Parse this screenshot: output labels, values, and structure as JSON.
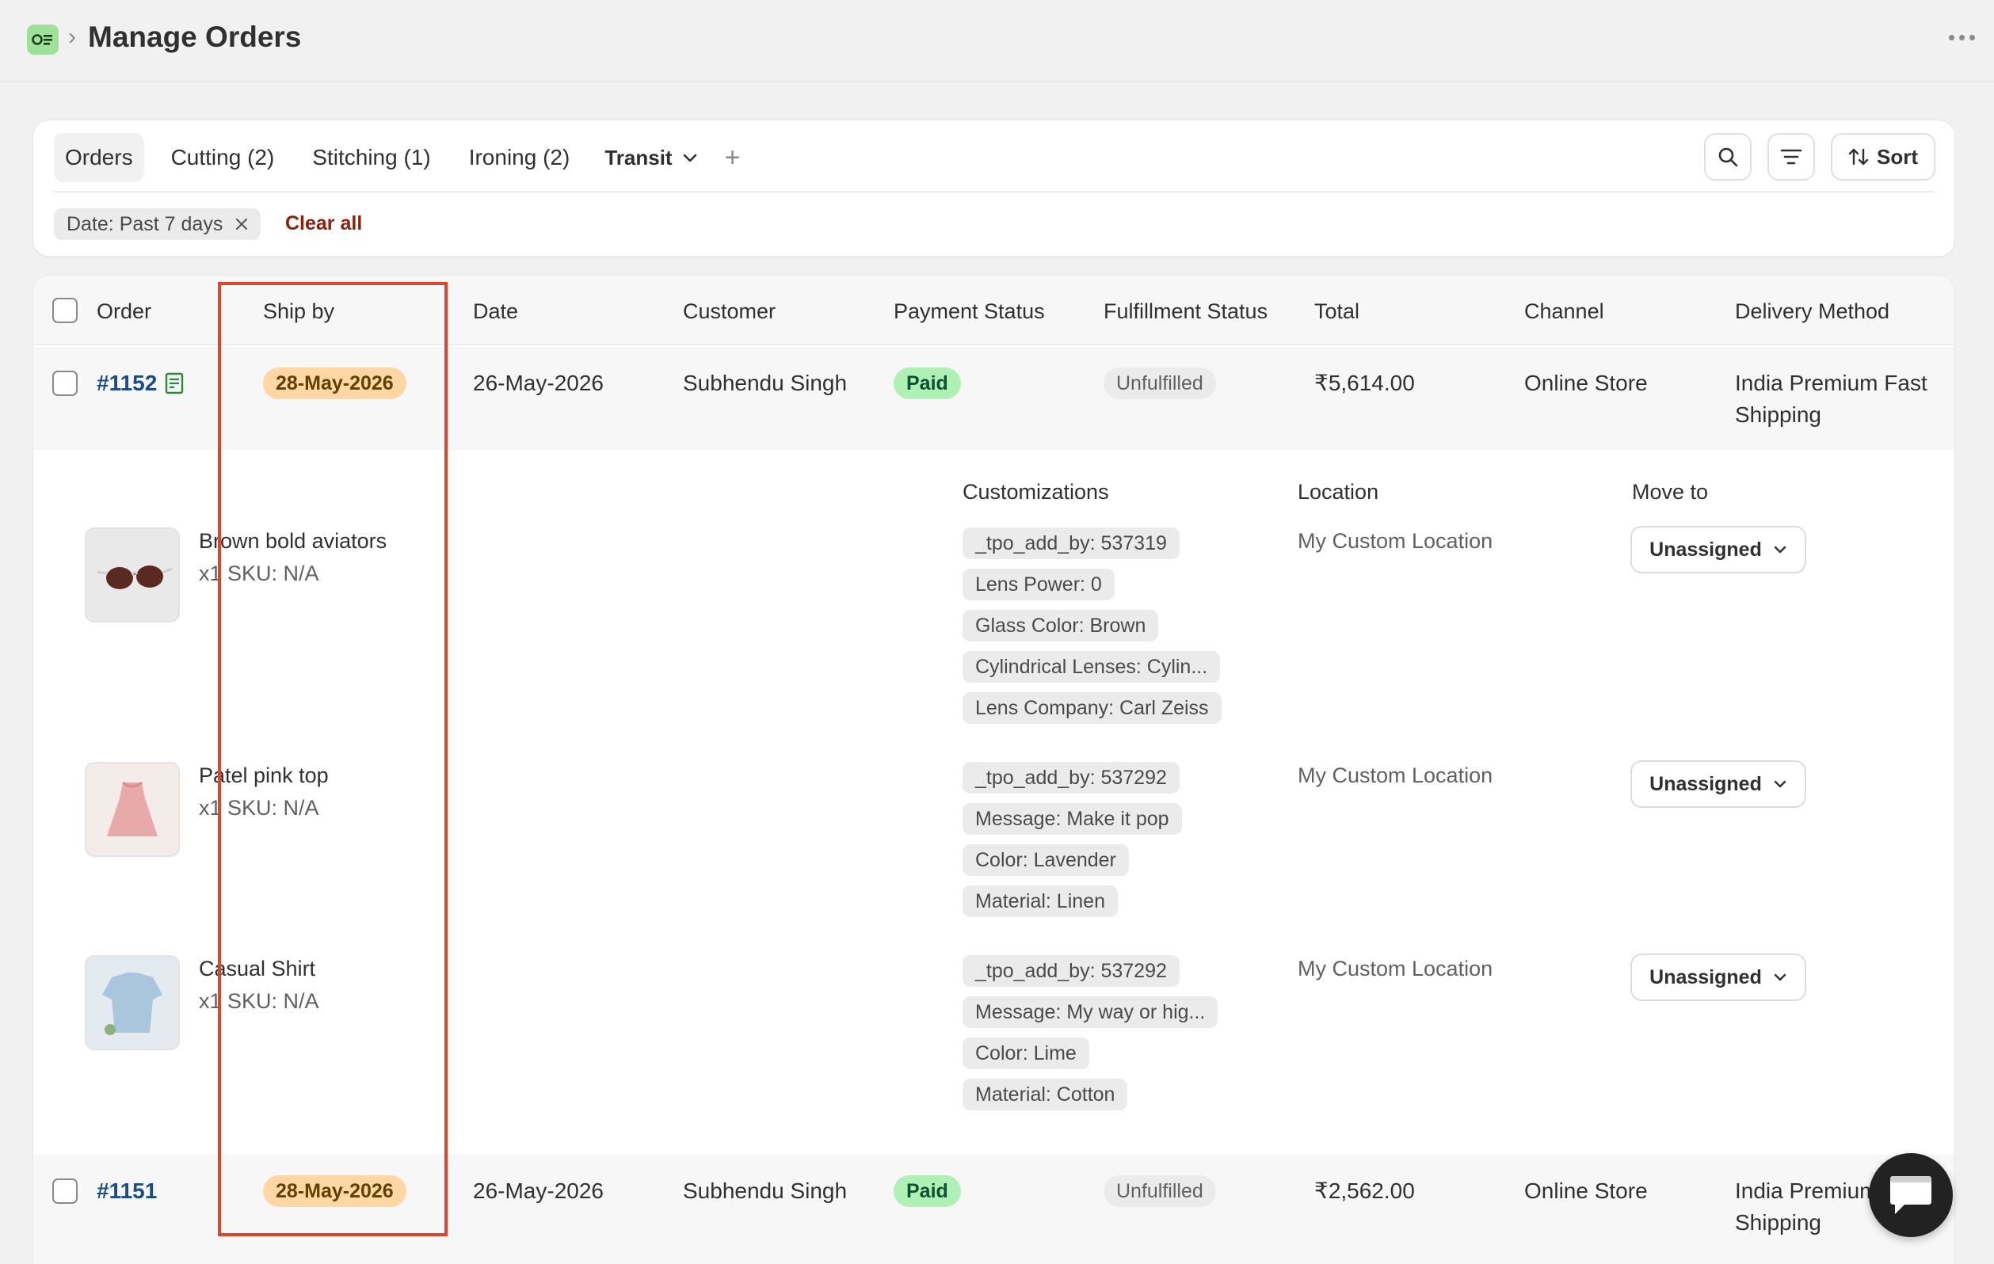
{
  "header": {
    "title": "Manage Orders",
    "app_icon": "orders-app-icon",
    "more_icon": "more-horizontal-icon"
  },
  "tabs": [
    {
      "label": "Orders",
      "active": true
    },
    {
      "label": "Cutting (2)"
    },
    {
      "label": "Stitching (1)"
    },
    {
      "label": "Ironing (2)"
    }
  ],
  "transit_tab": {
    "label": "Transit"
  },
  "toolbar": {
    "sort_label": "Sort"
  },
  "filters": {
    "chip_label": "Date: Past 7 days",
    "clear_all": "Clear all"
  },
  "columns": {
    "order": "Order",
    "ship_by": "Ship by",
    "date": "Date",
    "customer": "Customer",
    "payment": "Payment Status",
    "fulfillment": "Fulfillment Status",
    "total": "Total",
    "channel": "Channel",
    "delivery": "Delivery Method"
  },
  "orders": [
    {
      "id": "#1152",
      "ship_by": "28-May-2026",
      "date": "26-May-2026",
      "customer": "Subhendu Singh",
      "payment": "Paid",
      "fulfillment": "Unfulfilled",
      "total": "₹5,614.00",
      "channel": "Online Store",
      "delivery_line1": "India Premium Fast",
      "delivery_line2": "Shipping"
    },
    {
      "id": "#1151",
      "ship_by": "28-May-2026",
      "date": "26-May-2026",
      "customer": "Subhendu Singh",
      "payment": "Paid",
      "fulfillment": "Unfulfilled",
      "total": "₹2,562.00",
      "channel": "Online Store",
      "delivery_line1": "India Premium",
      "delivery_line2": "Shipping"
    }
  ],
  "line_item_headers": {
    "customizations": "Customizations",
    "location": "Location",
    "move_to": "Move to"
  },
  "line_items": [
    {
      "name": "Brown bold aviators",
      "sku": "x1 SKU: N/A",
      "customizations": [
        "_tpo_add_by: 537319",
        "Lens Power: 0",
        "Glass Color: Brown",
        "Cylindrical Lenses: Cylin...",
        "Lens Company: Carl Zeiss"
      ],
      "location": "My Custom Location",
      "move_to": "Unassigned"
    },
    {
      "name": "Patel pink top",
      "sku": "x1 SKU: N/A",
      "customizations": [
        "_tpo_add_by: 537292",
        "Message: Make it pop",
        "Color: Lavender",
        "Material: Linen"
      ],
      "location": "My Custom Location",
      "move_to": "Unassigned"
    },
    {
      "name": "Casual Shirt",
      "sku": "x1 SKU: N/A",
      "customizations": [
        "_tpo_add_by: 537292",
        "Message: My way or hig...",
        "Color: Lime",
        "Material: Cotton"
      ],
      "location": "My Custom Location",
      "move_to": "Unassigned"
    }
  ],
  "colors": {
    "accent_link": "#1a4c8b",
    "clear_all": "#8e1f0b",
    "ship_by_pill": "#ffd6a4",
    "paid_pill": "#aff0b5",
    "highlight": "#e0452b"
  }
}
